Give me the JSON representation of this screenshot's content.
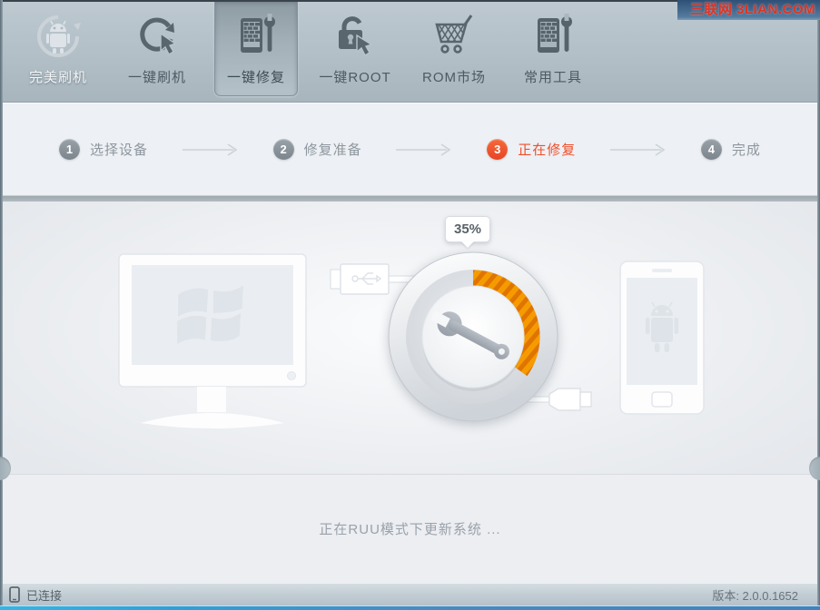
{
  "watermark": {
    "text": "三联网 3LIAN.COM"
  },
  "toolbar": {
    "items": [
      {
        "label": "完美刷机",
        "icon": "android-logo-icon",
        "active": false
      },
      {
        "label": "一键刷机",
        "icon": "one-key-flash-icon",
        "active": false
      },
      {
        "label": "一键修复",
        "icon": "one-key-repair-icon",
        "active": true
      },
      {
        "label": "一键ROOT",
        "icon": "one-key-root-icon",
        "active": false
      },
      {
        "label": "ROM市场",
        "icon": "rom-market-cart-icon",
        "active": false
      },
      {
        "label": "常用工具",
        "icon": "common-tools-icon",
        "active": false
      }
    ]
  },
  "steps": {
    "items": [
      {
        "num": "1",
        "label": "选择设备",
        "state": "normal"
      },
      {
        "num": "2",
        "label": "修复准备",
        "state": "normal"
      },
      {
        "num": "3",
        "label": "正在修复",
        "state": "active"
      },
      {
        "num": "4",
        "label": "完成",
        "state": "normal"
      }
    ]
  },
  "progress": {
    "percent_label": "35%",
    "value": 35
  },
  "main": {
    "message": "正在RUU模式下更新系统 ..."
  },
  "statusbar": {
    "connection_status": "已连接",
    "version": "版本: 2.0.0.1652"
  },
  "colors": {
    "accent_orange": "#f59b00",
    "accent_orange_dark": "#e07400",
    "active_red": "#ee4f2b",
    "bottom_bar_blue": "#3f8ec5"
  }
}
